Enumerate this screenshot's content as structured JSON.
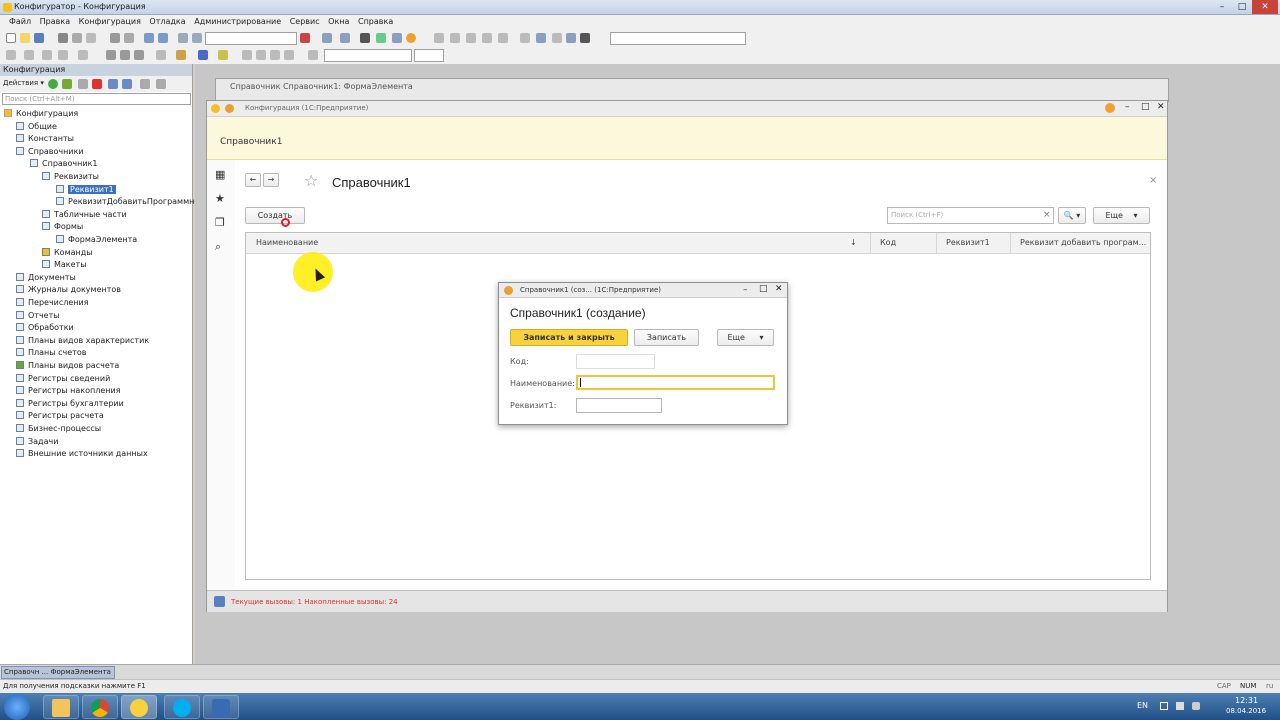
{
  "titlebar": {
    "title": "Конфигуратор - Конфигурация",
    "min": "–",
    "max": "□",
    "close": "✕"
  },
  "menu": [
    "Файл",
    "Правка",
    "Конфигурация",
    "Отладка",
    "Администрирование",
    "Сервис",
    "Окна",
    "Справка"
  ],
  "leftpanel": {
    "title": "Конфигурация",
    "actions_label": "Действия ▾",
    "search_placeholder": "Поиск (Ctrl+Alt+M)",
    "tree": [
      "Конфигурация",
      "Общие",
      "Константы",
      "Справочники",
      "Справочник1",
      "Реквизиты",
      "Реквизит1",
      "РеквизитДобавитьПрограммно",
      "Табличные части",
      "Формы",
      "ФормаЭлемента",
      "Команды",
      "Макеты",
      "Документы",
      "Журналы документов",
      "Перечисления",
      "Отчеты",
      "Обработки",
      "Планы видов характеристик",
      "Планы счетов",
      "Планы видов расчета",
      "Регистры сведений",
      "Регистры накопления",
      "Регистры бухгалтерии",
      "Регистры расчета",
      "Бизнес-процессы",
      "Задачи",
      "Внешние источники данных"
    ]
  },
  "bgwin": {
    "title": "Справочник Справочник1: ФормаЭлемента"
  },
  "enterprise": {
    "title": "Конфигурация  (1С:Предприятие)",
    "section": "Справочник1",
    "heading": "Справочник1",
    "back": "←",
    "forward": "→",
    "star": "☆",
    "close": "×",
    "create_button": "Создать",
    "search_placeholder": "Поиск (Ctrl+F)",
    "search_clear": "×",
    "search_button": "🔍 ▾",
    "more_button": "Еще",
    "more_arrow": "▾",
    "columns": [
      "Наименование",
      "↓",
      "Код",
      "Реквизит1",
      "Реквизит добавить програм..."
    ],
    "status_text": "Текущие вызовы: 1   Накопленные вызовы: 24"
  },
  "dialog": {
    "title": "Справочник1 (соз... (1С:Предприятие)",
    "heading": "Справочник1 (создание)",
    "save_close": "Записать и закрыть",
    "save": "Записать",
    "more": "Еще",
    "more_arrow": "▾",
    "fields": [
      {
        "label": "Код:",
        "value": ""
      },
      {
        "label": "Наименование:",
        "value": ""
      },
      {
        "label": "Реквизит1:",
        "value": ""
      }
    ]
  },
  "mditab": "Справочн ... ФормаЭлемента",
  "statusbar": {
    "hint": "Для получения подсказки нажмите F1",
    "cap": "CAP",
    "num": "NUM",
    "lang_short": "ru"
  },
  "taskbar": {
    "lang": "EN",
    "time": "12:31",
    "date": "08.04.2016"
  },
  "colors": {
    "accent_yellow": "#f7d23e",
    "title_bar": "#c3d2e6",
    "taskbar": "#1f4f86",
    "status_red": "#e03030"
  }
}
